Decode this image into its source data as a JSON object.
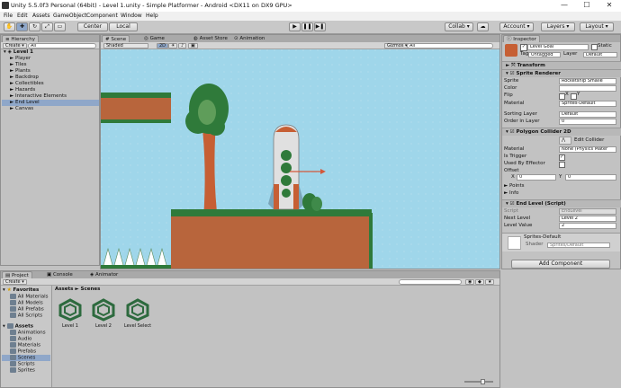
{
  "window": {
    "title": "Unity 5.5.0f3 Personal (64bit) - Level 1.unity - Simple Platformer - Android <DX11 on DX9 GPU>",
    "minimize": "—",
    "maximize": "☐",
    "close": "✕"
  },
  "menu": [
    "File",
    "Edit",
    "Assets",
    "GameObject",
    "Component",
    "Window",
    "Help"
  ],
  "toolbar": {
    "pivot": "Center",
    "space": "Local",
    "collab": "Collab ▾",
    "account": "Account ▾",
    "layers": "Layers ▾",
    "layout": "Layout ▾"
  },
  "hierarchy": {
    "tab": "Hierarchy",
    "create": "Create ▾",
    "search_placeholder": "All",
    "scene": "Level 1",
    "items": [
      "Player",
      "Tiles",
      "Plants",
      "Backdrop",
      "Collectibles",
      "Hazards",
      "Interactive Elements",
      "End Level",
      "Canvas"
    ],
    "selected": "End Level"
  },
  "scene": {
    "tabs": [
      "Scene",
      "Game",
      "Asset Store",
      "Animation"
    ],
    "shading": "Shaded",
    "mode2d": "2D",
    "gizmos": "Gizmos ▾",
    "search_placeholder": "All"
  },
  "inspector": {
    "tab": "Inspector",
    "object_name": "Level Goal",
    "static_label": "Static",
    "tag_label": "Tag",
    "tag_value": "Untagged",
    "layer_label": "Layer",
    "layer_value": "Default",
    "transform": "Transform",
    "sprite_renderer": {
      "title": "Sprite Renderer",
      "sprite_label": "Sprite",
      "sprite_value": "Rocketship Smalle",
      "color_label": "Color",
      "flip_label": "Flip",
      "flip_x": "X",
      "flip_y": "Y",
      "material_label": "Material",
      "material_value": "Sprites-Default",
      "sorting_layer_label": "Sorting Layer",
      "sorting_layer_value": "Default",
      "order_label": "Order in Layer",
      "order_value": "0"
    },
    "polygon_collider": {
      "title": "Polygon Collider 2D",
      "edit_collider": "Edit Collider",
      "material_label": "Material",
      "material_value": "None (Physics Mater",
      "is_trigger_label": "Is Trigger",
      "used_by_effector_label": "Used By Effector",
      "offset_label": "Offset",
      "x_label": "X",
      "x_value": "0",
      "y_label": "Y",
      "y_value": "0",
      "points_label": "Points",
      "info_label": "Info"
    },
    "end_level": {
      "title": "End Level (Script)",
      "script_label": "Script",
      "script_value": "EndLevel",
      "next_level_label": "Next Level",
      "next_level_value": "Level 2",
      "level_value_label": "Level Value",
      "level_value_value": "2"
    },
    "material": {
      "name": "Sprites-Default",
      "shader_label": "Shader",
      "shader_value": "Sprites/Default"
    },
    "add_component": "Add Component"
  },
  "project": {
    "tabs": [
      "Project",
      "Console",
      "Animator"
    ],
    "create": "Create ▾",
    "favorites_label": "Favorites",
    "favorites": [
      "All Materials",
      "All Models",
      "All Prefabs",
      "All Scripts"
    ],
    "assets_label": "Assets",
    "folders": [
      "Animations",
      "Audio",
      "Materials",
      "Prefabs",
      "Scenes",
      "Scripts",
      "Sprites"
    ],
    "selected_folder": "Scenes",
    "breadcrumb_root": "Assets",
    "breadcrumb_sep": "►",
    "breadcrumb_current": "Scenes",
    "assets": [
      "Level 1",
      "Level 2",
      "Level Select"
    ]
  },
  "colors": {
    "sky": "#9fd6ea",
    "dirt": "#b8653c",
    "grass": "#2f7a3a",
    "trunk": "#c65f34",
    "tree": "#2f7a3a",
    "selection": "#8fa7c9",
    "unity_icon": "#2d6a3e"
  }
}
